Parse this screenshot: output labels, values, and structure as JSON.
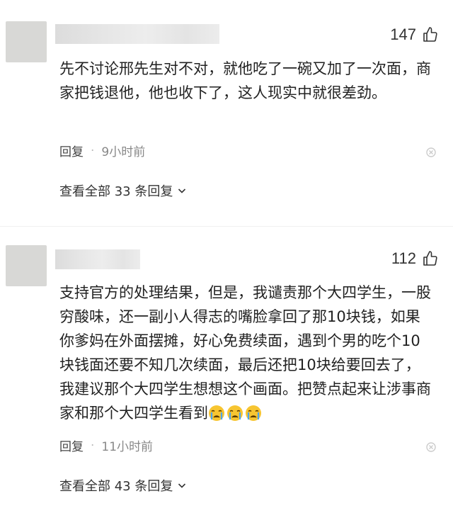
{
  "comments": [
    {
      "likes": "147",
      "text": "先不讨论邢先生对不对，就他吃了一碗又加了一次面，商家把钱退他，他也收下了，这人现实中就很差劲。",
      "reply_label": "回复",
      "separator": "·",
      "time": "9小时前",
      "view_replies": "查看全部 33 条回复"
    },
    {
      "likes": "112",
      "text": "支持官方的处理结果，但是，我谴责那个大四学生，一股穷酸味，还一副小人得志的嘴脸拿回了那10块钱，如果你爹妈在外面摆摊，好心免费续面，遇到个男的吃个10块钱面还要不知几次续面，最后还把10块给要回去了，我建议那个大四学生想想这个画面。把赞点起来让涉事商家和那个大四学生看到",
      "emojis": [
        "crying-face-emoji",
        "crying-face-emoji",
        "crying-face-emoji"
      ],
      "reply_label": "回复",
      "separator": "·",
      "time": "11小时前",
      "view_replies": "查看全部 43 条回复"
    }
  ],
  "colors": {
    "text": "#222222",
    "meta": "#888888",
    "avatar_placeholder": "#d8d8d6"
  }
}
